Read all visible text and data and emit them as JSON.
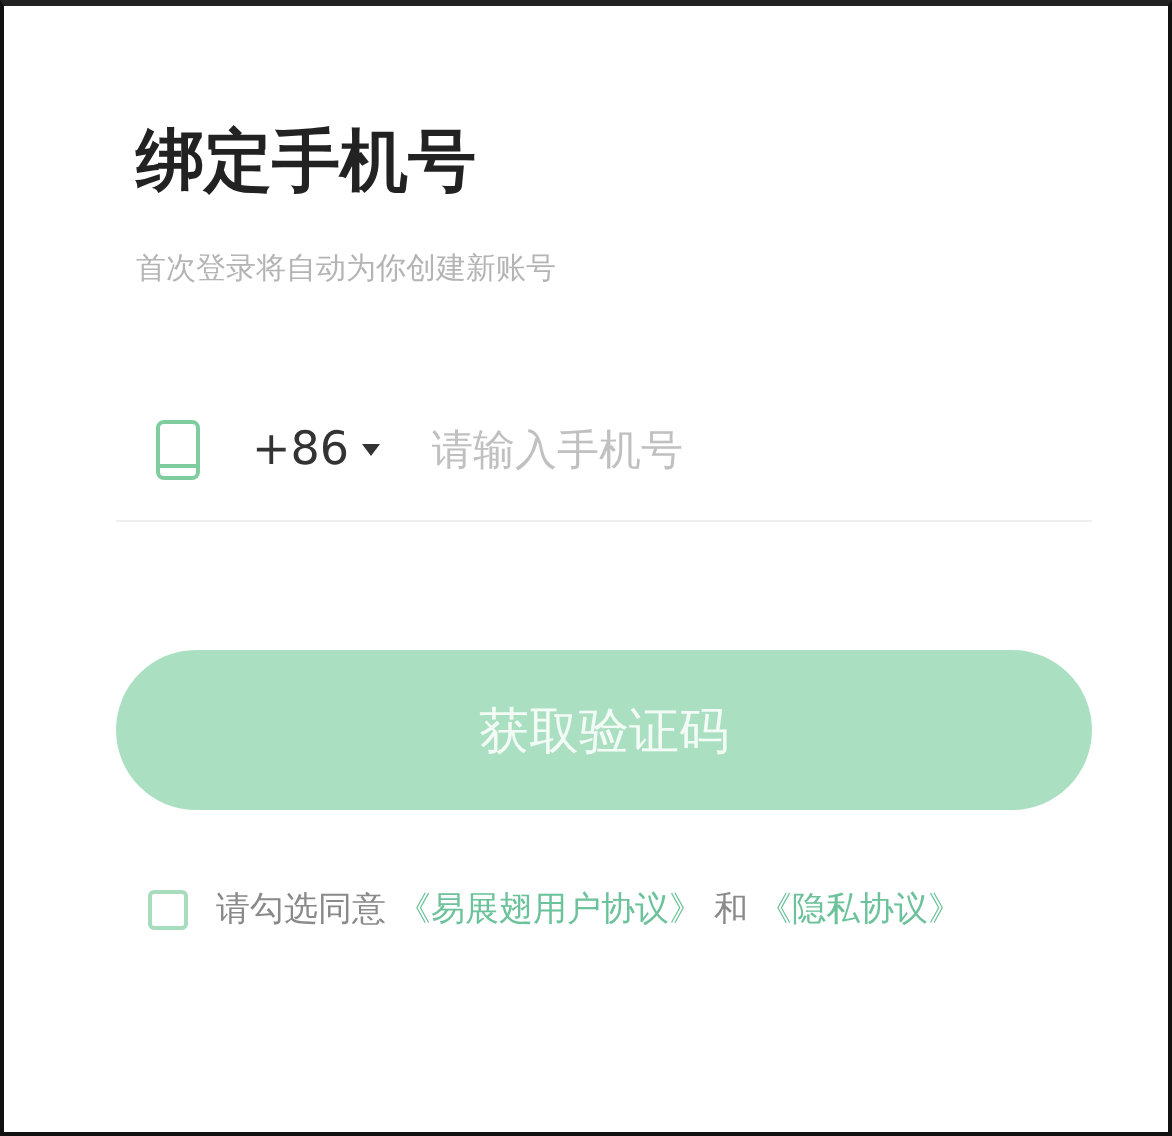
{
  "title": "绑定手机号",
  "subtitle": "首次登录将自动为你创建新账号",
  "phone": {
    "country_code": "+86",
    "placeholder": "请输入手机号"
  },
  "submit": {
    "label": "获取验证码",
    "disabled": true
  },
  "agreement": {
    "checked": false,
    "parts": [
      {
        "kind": "text",
        "text": "请勾选同意"
      },
      {
        "kind": "link",
        "text": "《易展翅用户协议》"
      },
      {
        "kind": "text",
        "text": "和"
      },
      {
        "kind": "link",
        "text": "《隐私协议》"
      }
    ]
  }
}
